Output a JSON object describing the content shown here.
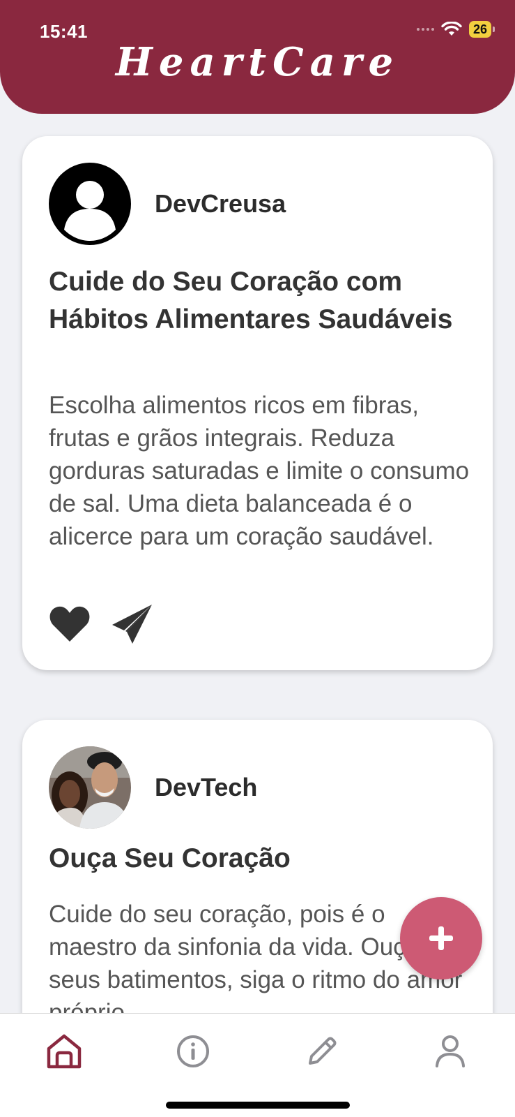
{
  "status_bar": {
    "time": "15:41",
    "battery": "26"
  },
  "app": {
    "title": "HeartCare"
  },
  "posts": [
    {
      "author": "DevCreusa",
      "avatar": "default-user-icon",
      "title": "Cuide do Seu Coração com Hábitos Alimentares Saudáveis",
      "body": "Escolha alimentos ricos em fibras, frutas e grãos integrais. Reduza gorduras saturadas e limite o consumo de sal. Uma dieta balanceada é o alicerce para um coração saudável."
    },
    {
      "author": "DevTech",
      "avatar": "user-photo",
      "title": "Ouça Seu Coração",
      "body": "Cuide do seu coração, pois é o maestro da sinfonia da vida. Ouça seus batimentos, siga o ritmo do amor próprio."
    }
  ],
  "tabs": [
    {
      "icon": "home-icon",
      "active": true
    },
    {
      "icon": "info-icon",
      "active": false
    },
    {
      "icon": "pencil-icon",
      "active": false
    },
    {
      "icon": "user-icon",
      "active": false
    }
  ],
  "colors": {
    "brand": "#8a283f",
    "fab": "#cd5a74",
    "active_tab": "#8a283f",
    "inactive_tab": "#8e8e93"
  }
}
